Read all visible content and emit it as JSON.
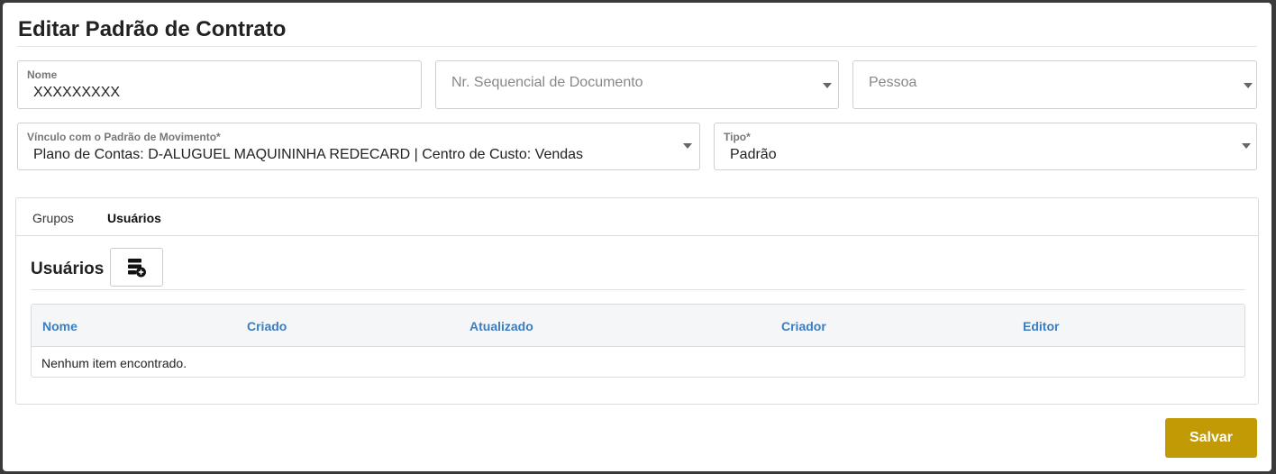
{
  "dialog": {
    "title": "Editar Padrão de Contrato"
  },
  "form": {
    "nome": {
      "label": "Nome",
      "value": "XXXXXXXXX"
    },
    "nr_sequencial": {
      "placeholder": "Nr. Sequencial de Documento"
    },
    "pessoa": {
      "placeholder": "Pessoa"
    },
    "vinculo": {
      "label": "Vínculo com o Padrão de Movimento*",
      "value": "Plano de Contas: D-ALUGUEL MAQUININHA REDECARD | Centro de Custo: Vendas"
    },
    "tipo": {
      "label": "Tipo*",
      "value": "Padrão"
    }
  },
  "tabs": [
    {
      "label": "Grupos",
      "active": false
    },
    {
      "label": "Usuários",
      "active": true
    }
  ],
  "section": {
    "title": "Usuários"
  },
  "table": {
    "columns": [
      "Nome",
      "Criado",
      "Atualizado",
      "Criador",
      "Editor"
    ],
    "empty_message": "Nenhum item encontrado."
  },
  "actions": {
    "save_label": "Salvar"
  },
  "colors": {
    "accent": "#c19a06",
    "column_header": "#3c7dbf"
  }
}
